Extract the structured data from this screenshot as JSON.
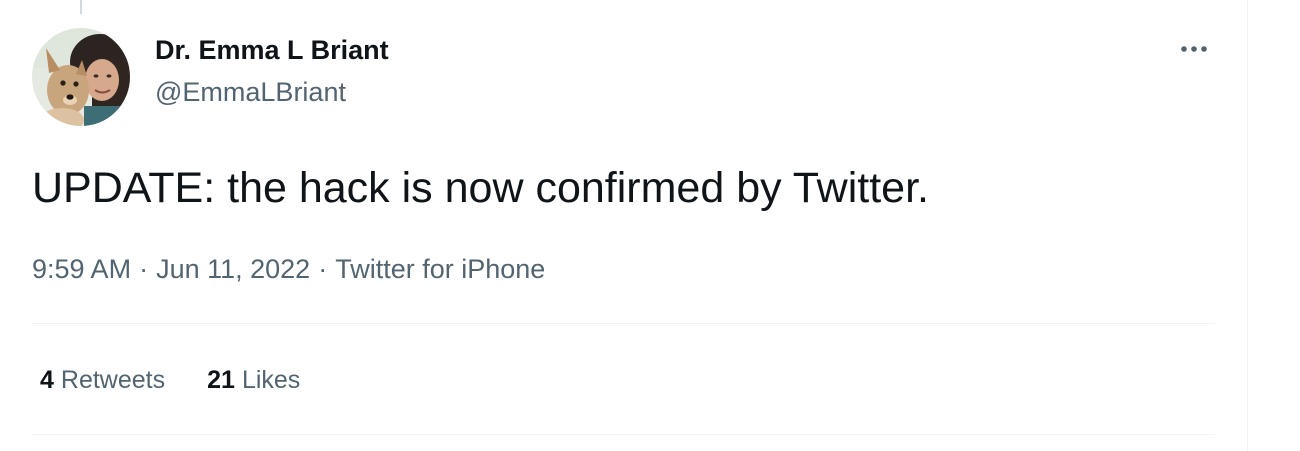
{
  "tweet": {
    "author": {
      "display_name": "Dr. Emma L Briant",
      "handle": "@EmmaLBriant",
      "avatar_icon": "profile-photo-with-dog"
    },
    "text": "UPDATE: the hack is now confirmed by Twitter.",
    "time": "9:59 AM",
    "date": "Jun 11, 2022",
    "source": "Twitter for iPhone",
    "separator": "·",
    "more_icon": "more-horizontal-icon",
    "stats": {
      "retweets_count": "4",
      "retweets_label": "Retweets",
      "likes_count": "21",
      "likes_label": "Likes"
    }
  },
  "colors": {
    "primary_text": "#0f1419",
    "secondary_text": "#536471",
    "divider": "#eff3f4"
  }
}
